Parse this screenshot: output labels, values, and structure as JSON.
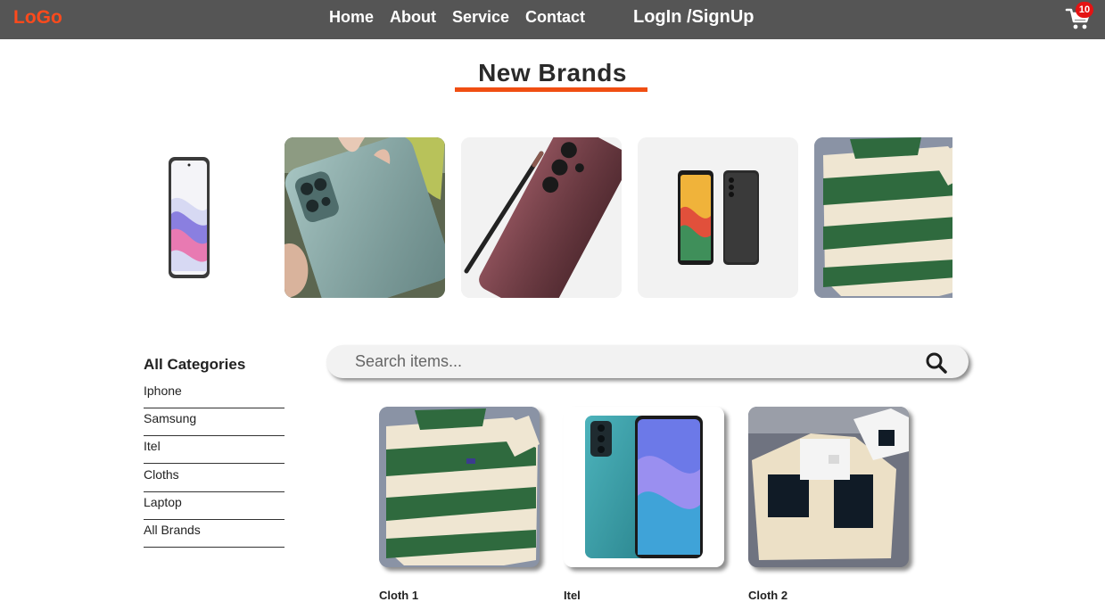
{
  "navbar": {
    "logo": "LoGo",
    "links": [
      "Home",
      "About",
      "Service",
      "Contact"
    ],
    "login": "LogIn /SignUp",
    "cart_icon": "shopping-cart-icon",
    "cart_count": "10"
  },
  "colors": {
    "navbar_bg": "#555555",
    "accent": "#f04e12",
    "badge": "#e41313"
  },
  "brands": {
    "title": "New Brands",
    "slides": [
      "phone-white-image",
      "phone-green-in-hand-image",
      "phone-burgundy-with-stylus-image",
      "two-phones-image",
      "striped-sweater-image"
    ]
  },
  "sidebar": {
    "title": "All Categories",
    "items": [
      "Iphone",
      "Samsung",
      "Itel",
      "Cloths",
      "Laptop",
      "All Brands"
    ]
  },
  "search": {
    "placeholder": "Search items...",
    "icon": "search-icon"
  },
  "products": [
    {
      "name": "Cloth 1",
      "image": "striped-sweater-image"
    },
    {
      "name": "Itel",
      "image": "teal-phone-image"
    },
    {
      "name": "Cloth 2",
      "image": "patchwork-sweater-image"
    }
  ]
}
